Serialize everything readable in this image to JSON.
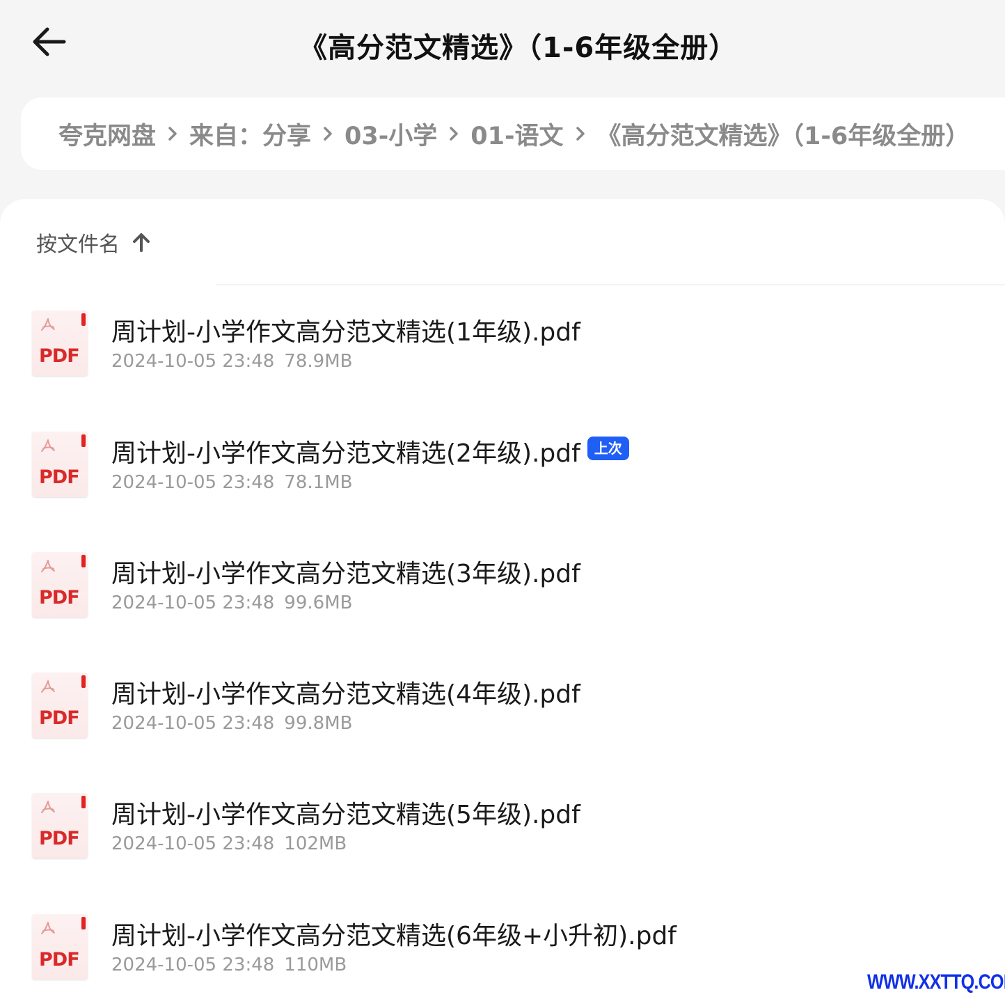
{
  "header": {
    "title": "《高分范文精选》（1-6年级全册）"
  },
  "breadcrumb": [
    "夸克网盘",
    "来自：分享",
    "03-小学",
    "01-语文",
    "《高分范文精选》（1-6年级全册）"
  ],
  "sort": {
    "label": "按文件名",
    "direction": "ascending"
  },
  "files": [
    {
      "name": "周计划-小学作文高分范文精选(1年级).pdf",
      "date": "2024-10-05 23:48",
      "size": "78.9MB",
      "type_label": "PDF"
    },
    {
      "name": "周计划-小学作文高分范文精选(2年级).pdf",
      "date": "2024-10-05 23:48",
      "size": "78.1MB",
      "type_label": "PDF",
      "badge": "上次"
    },
    {
      "name": "周计划-小学作文高分范文精选(3年级).pdf",
      "date": "2024-10-05 23:48",
      "size": "99.6MB",
      "type_label": "PDF"
    },
    {
      "name": "周计划-小学作文高分范文精选(4年级).pdf",
      "date": "2024-10-05 23:48",
      "size": "99.8MB",
      "type_label": "PDF"
    },
    {
      "name": "周计划-小学作文高分范文精选(5年级).pdf",
      "date": "2024-10-05 23:48",
      "size": "102MB",
      "type_label": "PDF"
    },
    {
      "name": "周计划-小学作文高分范文精选(6年级+小升初).pdf",
      "date": "2024-10-05 23:48",
      "size": "110MB",
      "type_label": "PDF"
    }
  ],
  "watermark": "WWW.XXTTQ.COM",
  "colors": {
    "pdf_red": "#d92a2a",
    "badge_blue": "#1f5ff5",
    "watermark_blue": "#1030e8"
  }
}
